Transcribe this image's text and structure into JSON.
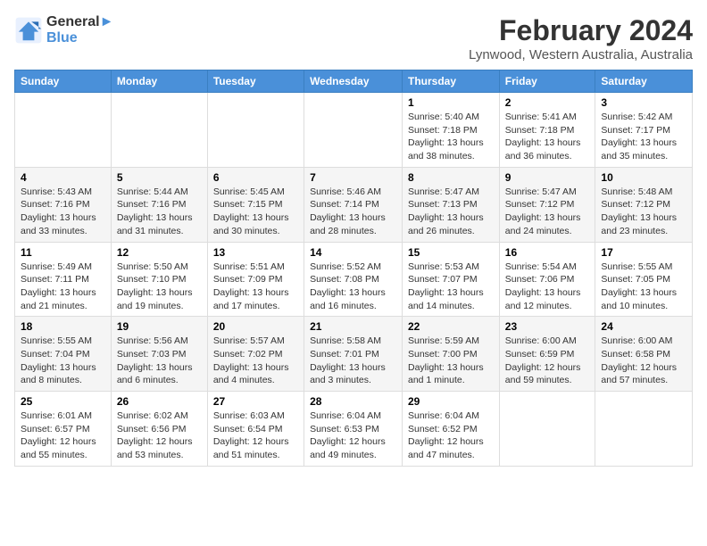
{
  "header": {
    "logo_line1": "General",
    "logo_line2": "Blue",
    "title": "February 2024",
    "subtitle": "Lynwood, Western Australia, Australia"
  },
  "days_of_week": [
    "Sunday",
    "Monday",
    "Tuesday",
    "Wednesday",
    "Thursday",
    "Friday",
    "Saturday"
  ],
  "weeks": [
    [
      {
        "day": "",
        "sunrise": "",
        "sunset": "",
        "daylight": ""
      },
      {
        "day": "",
        "sunrise": "",
        "sunset": "",
        "daylight": ""
      },
      {
        "day": "",
        "sunrise": "",
        "sunset": "",
        "daylight": ""
      },
      {
        "day": "",
        "sunrise": "",
        "sunset": "",
        "daylight": ""
      },
      {
        "day": "1",
        "sunrise": "Sunrise: 5:40 AM",
        "sunset": "Sunset: 7:18 PM",
        "daylight": "Daylight: 13 hours and 38 minutes."
      },
      {
        "day": "2",
        "sunrise": "Sunrise: 5:41 AM",
        "sunset": "Sunset: 7:18 PM",
        "daylight": "Daylight: 13 hours and 36 minutes."
      },
      {
        "day": "3",
        "sunrise": "Sunrise: 5:42 AM",
        "sunset": "Sunset: 7:17 PM",
        "daylight": "Daylight: 13 hours and 35 minutes."
      }
    ],
    [
      {
        "day": "4",
        "sunrise": "Sunrise: 5:43 AM",
        "sunset": "Sunset: 7:16 PM",
        "daylight": "Daylight: 13 hours and 33 minutes."
      },
      {
        "day": "5",
        "sunrise": "Sunrise: 5:44 AM",
        "sunset": "Sunset: 7:16 PM",
        "daylight": "Daylight: 13 hours and 31 minutes."
      },
      {
        "day": "6",
        "sunrise": "Sunrise: 5:45 AM",
        "sunset": "Sunset: 7:15 PM",
        "daylight": "Daylight: 13 hours and 30 minutes."
      },
      {
        "day": "7",
        "sunrise": "Sunrise: 5:46 AM",
        "sunset": "Sunset: 7:14 PM",
        "daylight": "Daylight: 13 hours and 28 minutes."
      },
      {
        "day": "8",
        "sunrise": "Sunrise: 5:47 AM",
        "sunset": "Sunset: 7:13 PM",
        "daylight": "Daylight: 13 hours and 26 minutes."
      },
      {
        "day": "9",
        "sunrise": "Sunrise: 5:47 AM",
        "sunset": "Sunset: 7:12 PM",
        "daylight": "Daylight: 13 hours and 24 minutes."
      },
      {
        "day": "10",
        "sunrise": "Sunrise: 5:48 AM",
        "sunset": "Sunset: 7:12 PM",
        "daylight": "Daylight: 13 hours and 23 minutes."
      }
    ],
    [
      {
        "day": "11",
        "sunrise": "Sunrise: 5:49 AM",
        "sunset": "Sunset: 7:11 PM",
        "daylight": "Daylight: 13 hours and 21 minutes."
      },
      {
        "day": "12",
        "sunrise": "Sunrise: 5:50 AM",
        "sunset": "Sunset: 7:10 PM",
        "daylight": "Daylight: 13 hours and 19 minutes."
      },
      {
        "day": "13",
        "sunrise": "Sunrise: 5:51 AM",
        "sunset": "Sunset: 7:09 PM",
        "daylight": "Daylight: 13 hours and 17 minutes."
      },
      {
        "day": "14",
        "sunrise": "Sunrise: 5:52 AM",
        "sunset": "Sunset: 7:08 PM",
        "daylight": "Daylight: 13 hours and 16 minutes."
      },
      {
        "day": "15",
        "sunrise": "Sunrise: 5:53 AM",
        "sunset": "Sunset: 7:07 PM",
        "daylight": "Daylight: 13 hours and 14 minutes."
      },
      {
        "day": "16",
        "sunrise": "Sunrise: 5:54 AM",
        "sunset": "Sunset: 7:06 PM",
        "daylight": "Daylight: 13 hours and 12 minutes."
      },
      {
        "day": "17",
        "sunrise": "Sunrise: 5:55 AM",
        "sunset": "Sunset: 7:05 PM",
        "daylight": "Daylight: 13 hours and 10 minutes."
      }
    ],
    [
      {
        "day": "18",
        "sunrise": "Sunrise: 5:55 AM",
        "sunset": "Sunset: 7:04 PM",
        "daylight": "Daylight: 13 hours and 8 minutes."
      },
      {
        "day": "19",
        "sunrise": "Sunrise: 5:56 AM",
        "sunset": "Sunset: 7:03 PM",
        "daylight": "Daylight: 13 hours and 6 minutes."
      },
      {
        "day": "20",
        "sunrise": "Sunrise: 5:57 AM",
        "sunset": "Sunset: 7:02 PM",
        "daylight": "Daylight: 13 hours and 4 minutes."
      },
      {
        "day": "21",
        "sunrise": "Sunrise: 5:58 AM",
        "sunset": "Sunset: 7:01 PM",
        "daylight": "Daylight: 13 hours and 3 minutes."
      },
      {
        "day": "22",
        "sunrise": "Sunrise: 5:59 AM",
        "sunset": "Sunset: 7:00 PM",
        "daylight": "Daylight: 13 hours and 1 minute."
      },
      {
        "day": "23",
        "sunrise": "Sunrise: 6:00 AM",
        "sunset": "Sunset: 6:59 PM",
        "daylight": "Daylight: 12 hours and 59 minutes."
      },
      {
        "day": "24",
        "sunrise": "Sunrise: 6:00 AM",
        "sunset": "Sunset: 6:58 PM",
        "daylight": "Daylight: 12 hours and 57 minutes."
      }
    ],
    [
      {
        "day": "25",
        "sunrise": "Sunrise: 6:01 AM",
        "sunset": "Sunset: 6:57 PM",
        "daylight": "Daylight: 12 hours and 55 minutes."
      },
      {
        "day": "26",
        "sunrise": "Sunrise: 6:02 AM",
        "sunset": "Sunset: 6:56 PM",
        "daylight": "Daylight: 12 hours and 53 minutes."
      },
      {
        "day": "27",
        "sunrise": "Sunrise: 6:03 AM",
        "sunset": "Sunset: 6:54 PM",
        "daylight": "Daylight: 12 hours and 51 minutes."
      },
      {
        "day": "28",
        "sunrise": "Sunrise: 6:04 AM",
        "sunset": "Sunset: 6:53 PM",
        "daylight": "Daylight: 12 hours and 49 minutes."
      },
      {
        "day": "29",
        "sunrise": "Sunrise: 6:04 AM",
        "sunset": "Sunset: 6:52 PM",
        "daylight": "Daylight: 12 hours and 47 minutes."
      },
      {
        "day": "",
        "sunrise": "",
        "sunset": "",
        "daylight": ""
      },
      {
        "day": "",
        "sunrise": "",
        "sunset": "",
        "daylight": ""
      }
    ]
  ]
}
